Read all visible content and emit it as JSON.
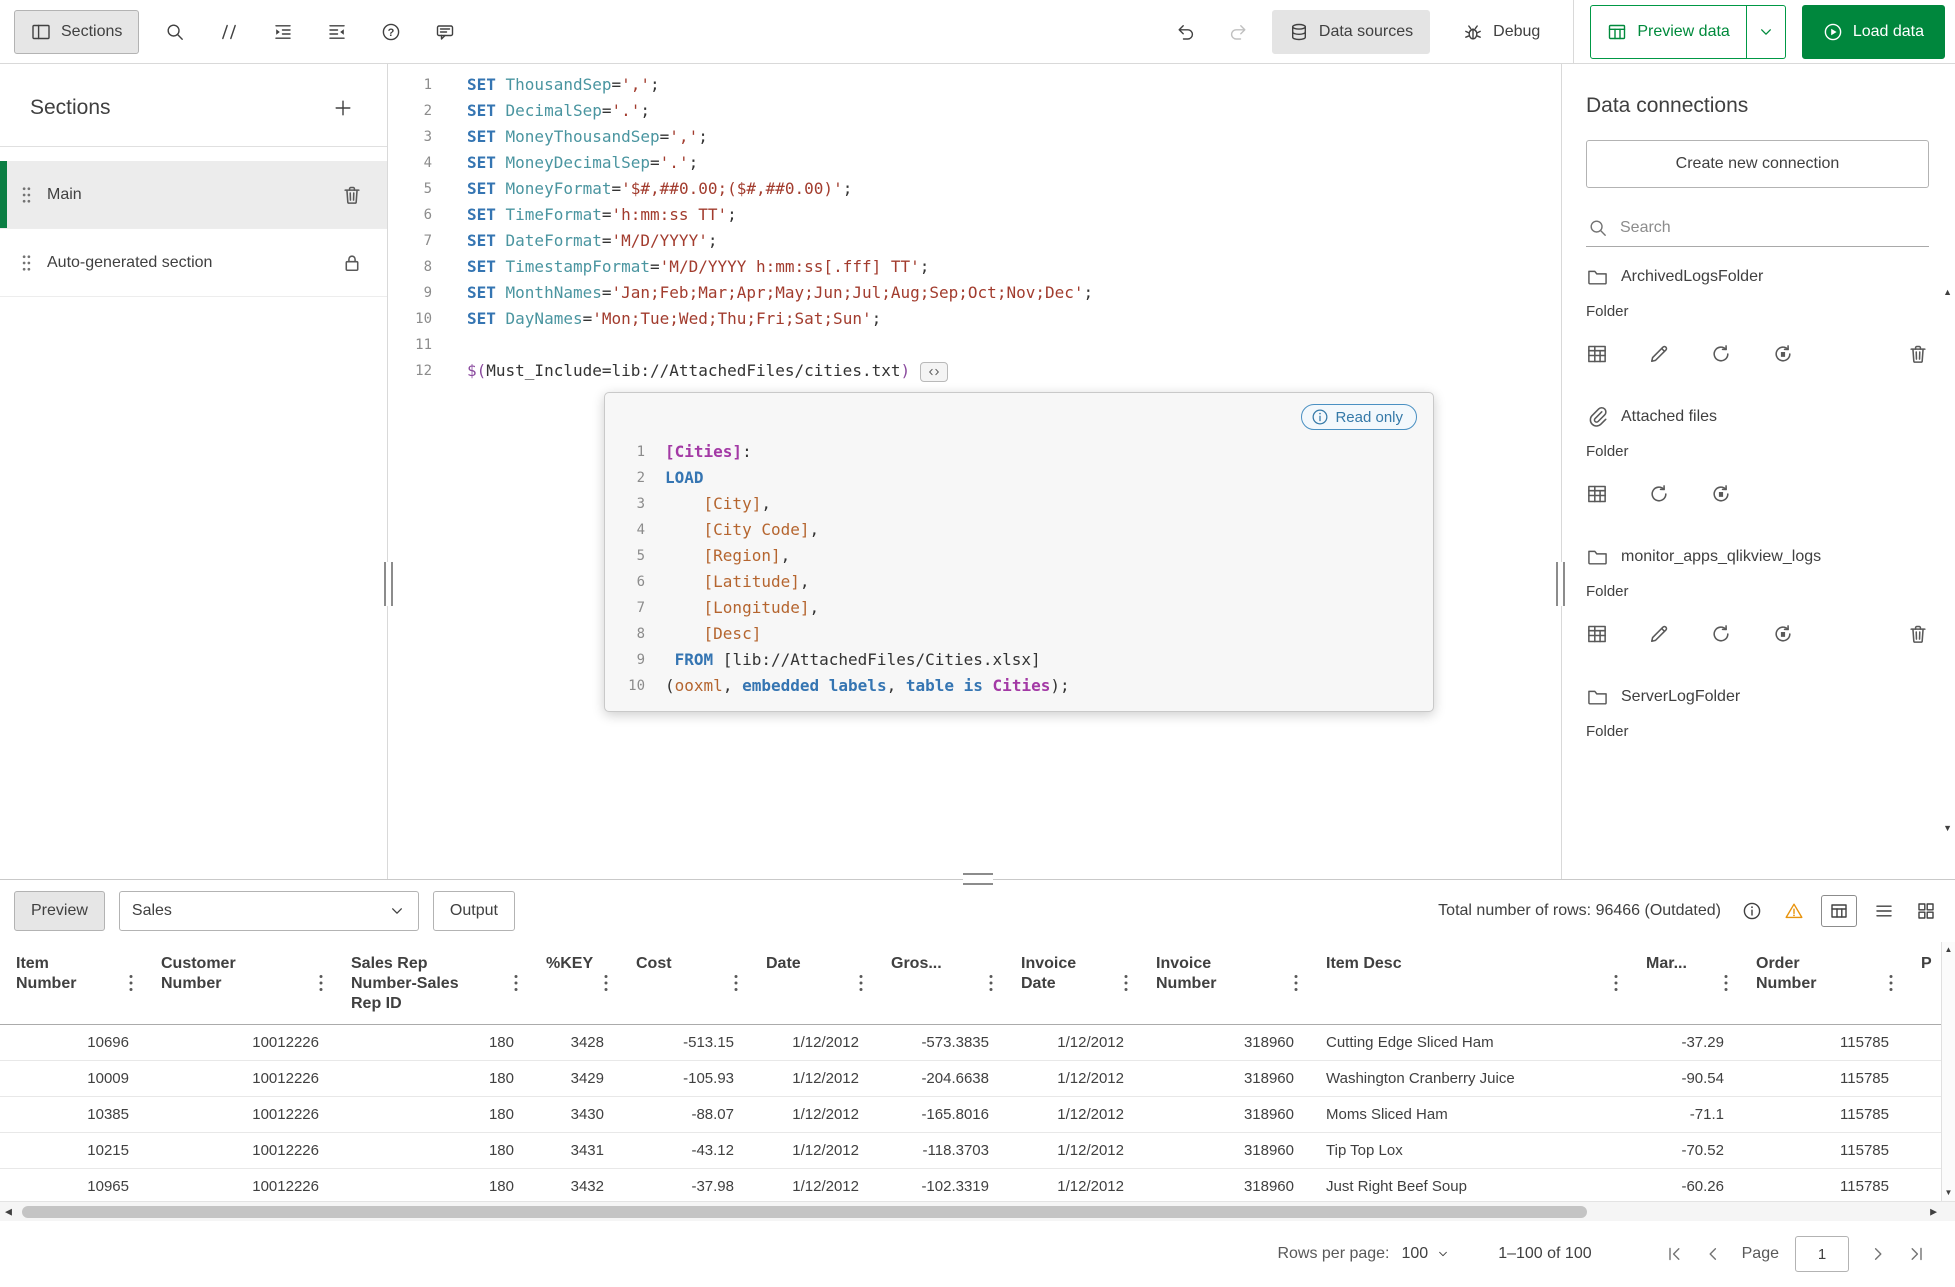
{
  "topbar": {
    "sections_button": "Sections",
    "data_sources_button": "Data sources",
    "debug_button": "Debug",
    "preview_data_button": "Preview data",
    "load_data_button": "Load data"
  },
  "sections_panel": {
    "title": "Sections",
    "items": [
      {
        "label": "Main",
        "selected": true,
        "action": "trash"
      },
      {
        "label": "Auto-generated section",
        "selected": false,
        "action": "lock"
      }
    ]
  },
  "editor": {
    "main_code": [
      {
        "num": "1",
        "tokens": [
          [
            "SET ",
            "kw"
          ],
          [
            "ThousandSep",
            "name"
          ],
          [
            "=",
            "plain"
          ],
          [
            "','",
            "str"
          ],
          [
            ";",
            "plain"
          ]
        ]
      },
      {
        "num": "2",
        "tokens": [
          [
            "SET ",
            "kw"
          ],
          [
            "DecimalSep",
            "name"
          ],
          [
            "=",
            "plain"
          ],
          [
            "'.'",
            "str"
          ],
          [
            ";",
            "plain"
          ]
        ]
      },
      {
        "num": "3",
        "tokens": [
          [
            "SET ",
            "kw"
          ],
          [
            "MoneyThousandSep",
            "name"
          ],
          [
            "=",
            "plain"
          ],
          [
            "','",
            "str"
          ],
          [
            ";",
            "plain"
          ]
        ]
      },
      {
        "num": "4",
        "tokens": [
          [
            "SET ",
            "kw"
          ],
          [
            "MoneyDecimalSep",
            "name"
          ],
          [
            "=",
            "plain"
          ],
          [
            "'.'",
            "str"
          ],
          [
            ";",
            "plain"
          ]
        ]
      },
      {
        "num": "5",
        "tokens": [
          [
            "SET ",
            "kw"
          ],
          [
            "MoneyFormat",
            "name"
          ],
          [
            "=",
            "plain"
          ],
          [
            "'$#,##0.00;($#,##0.00)'",
            "str"
          ],
          [
            ";",
            "plain"
          ]
        ]
      },
      {
        "num": "6",
        "tokens": [
          [
            "SET ",
            "kw"
          ],
          [
            "TimeFormat",
            "name"
          ],
          [
            "=",
            "plain"
          ],
          [
            "'h:mm:ss TT'",
            "str"
          ],
          [
            ";",
            "plain"
          ]
        ]
      },
      {
        "num": "7",
        "tokens": [
          [
            "SET ",
            "kw"
          ],
          [
            "DateFormat",
            "name"
          ],
          [
            "=",
            "plain"
          ],
          [
            "'M/D/YYYY'",
            "str"
          ],
          [
            ";",
            "plain"
          ]
        ]
      },
      {
        "num": "8",
        "tokens": [
          [
            "SET ",
            "kw"
          ],
          [
            "TimestampFormat",
            "name"
          ],
          [
            "=",
            "plain"
          ],
          [
            "'M/D/YYYY h:mm:ss[.fff] TT'",
            "str"
          ],
          [
            ";",
            "plain"
          ]
        ]
      },
      {
        "num": "9",
        "tokens": [
          [
            "SET ",
            "kw"
          ],
          [
            "MonthNames",
            "name"
          ],
          [
            "=",
            "plain"
          ],
          [
            "'Jan;Feb;Mar;Apr;May;Jun;Jul;Aug;Sep;Oct;Nov;Dec'",
            "str"
          ],
          [
            ";",
            "plain"
          ]
        ]
      },
      {
        "num": "10",
        "tokens": [
          [
            "SET ",
            "kw"
          ],
          [
            "DayNames",
            "name"
          ],
          [
            "=",
            "plain"
          ],
          [
            "'Mon;Tue;Wed;Thu;Fri;Sat;Sun'",
            "str"
          ],
          [
            ";",
            "plain"
          ]
        ]
      },
      {
        "num": "11",
        "tokens": []
      },
      {
        "num": "12",
        "tokens": [
          [
            "$(",
            "dollar"
          ],
          [
            "Must_Include=lib://AttachedFiles/cities.txt",
            "plain"
          ],
          [
            ")",
            "dollar"
          ]
        ],
        "widget": "code-expand"
      }
    ],
    "popup": {
      "read_only_label": "Read only",
      "code": [
        {
          "num": "1",
          "tokens": [
            [
              "[Cities]",
              "table"
            ],
            [
              ":",
              "plain"
            ]
          ]
        },
        {
          "num": "2",
          "tokens": [
            [
              "LOAD",
              "kw"
            ]
          ]
        },
        {
          "num": "3",
          "tokens": [
            [
              "    ",
              "plain"
            ],
            [
              "[City]",
              "field"
            ],
            [
              ",",
              "plain"
            ]
          ]
        },
        {
          "num": "4",
          "tokens": [
            [
              "    ",
              "plain"
            ],
            [
              "[City Code]",
              "field"
            ],
            [
              ",",
              "plain"
            ]
          ]
        },
        {
          "num": "5",
          "tokens": [
            [
              "    ",
              "plain"
            ],
            [
              "[Region]",
              "field"
            ],
            [
              ",",
              "plain"
            ]
          ]
        },
        {
          "num": "6",
          "tokens": [
            [
              "    ",
              "plain"
            ],
            [
              "[Latitude]",
              "field"
            ],
            [
              ",",
              "plain"
            ]
          ]
        },
        {
          "num": "7",
          "tokens": [
            [
              "    ",
              "plain"
            ],
            [
              "[Longitude]",
              "field"
            ],
            [
              ",",
              "plain"
            ]
          ]
        },
        {
          "num": "8",
          "tokens": [
            [
              "    ",
              "plain"
            ],
            [
              "[Desc]",
              "field"
            ]
          ]
        },
        {
          "num": "9",
          "tokens": [
            [
              " ",
              "plain"
            ],
            [
              "FROM",
              "kw"
            ],
            [
              " [lib://AttachedFiles/Cities.xlsx]",
              "plain"
            ]
          ]
        },
        {
          "num": "10",
          "tokens": [
            [
              "(",
              "plain"
            ],
            [
              "ooxml",
              "field"
            ],
            [
              ", ",
              "plain"
            ],
            [
              "embedded labels",
              "kw"
            ],
            [
              ", ",
              "plain"
            ],
            [
              "table is",
              "kw"
            ],
            [
              " ",
              "plain"
            ],
            [
              "Cities",
              "table"
            ],
            [
              ");",
              "plain"
            ]
          ]
        }
      ]
    }
  },
  "connections": {
    "title": "Data connections",
    "create_button": "Create new connection",
    "search_placeholder": "Search",
    "items": [
      {
        "name": "ArchivedLogsFolder",
        "type": "Folder",
        "icon": "folder",
        "actions": [
          "select-data",
          "edit",
          "sync",
          "reload-script"
        ],
        "deletable": true
      },
      {
        "name": "Attached files",
        "type": "Folder",
        "icon": "paperclip",
        "actions": [
          "select-data",
          "sync",
          "reload-script"
        ],
        "deletable": false
      },
      {
        "name": "monitor_apps_qlikview_logs",
        "type": "Folder",
        "icon": "folder",
        "actions": [
          "select-data",
          "edit",
          "sync",
          "reload-script"
        ],
        "deletable": true
      },
      {
        "name": "ServerLogFolder",
        "type": "Folder",
        "icon": "folder",
        "actions": [],
        "deletable": false
      }
    ]
  },
  "preview": {
    "preview_button": "Preview",
    "table_selector_value": "Sales",
    "output_button": "Output",
    "total_rows_text": "Total number of rows: 96466 (Outdated)",
    "columns": [
      {
        "label": "Item Number",
        "align": "right"
      },
      {
        "label": "Customer Number",
        "align": "right"
      },
      {
        "label": "Sales Rep Number-Sales Rep ID",
        "align": "right"
      },
      {
        "label": "%KEY",
        "align": "right"
      },
      {
        "label": "Cost",
        "align": "right"
      },
      {
        "label": "Date",
        "align": "right"
      },
      {
        "label": "Gros...",
        "align": "right"
      },
      {
        "label": "Invoice Date",
        "align": "right"
      },
      {
        "label": "Invoice Number",
        "align": "right"
      },
      {
        "label": "Item Desc",
        "align": "left"
      },
      {
        "label": "Mar...",
        "align": "right"
      },
      {
        "label": "Order Number",
        "align": "right"
      },
      {
        "label": "P",
        "align": "left"
      }
    ],
    "rows": [
      [
        "10696",
        "10012226",
        "180",
        "3428",
        "-513.15",
        "1/12/2012",
        "-573.3835",
        "1/12/2012",
        "318960",
        "Cutting Edge Sliced Ham",
        "-37.29",
        "115785",
        ""
      ],
      [
        "10009",
        "10012226",
        "180",
        "3429",
        "-105.93",
        "1/12/2012",
        "-204.6638",
        "1/12/2012",
        "318960",
        "Washington Cranberry Juice",
        "-90.54",
        "115785",
        ""
      ],
      [
        "10385",
        "10012226",
        "180",
        "3430",
        "-88.07",
        "1/12/2012",
        "-165.8016",
        "1/12/2012",
        "318960",
        "Moms Sliced Ham",
        "-71.1",
        "115785",
        ""
      ],
      [
        "10215",
        "10012226",
        "180",
        "3431",
        "-43.12",
        "1/12/2012",
        "-118.3703",
        "1/12/2012",
        "318960",
        "Tip Top Lox",
        "-70.52",
        "115785",
        ""
      ],
      [
        "10965",
        "10012226",
        "180",
        "3432",
        "-37.98",
        "1/12/2012",
        "-102.3319",
        "1/12/2012",
        "318960",
        "Just Right Beef Soup",
        "-60.26",
        "115785",
        ""
      ]
    ],
    "pagination": {
      "rows_per_page_label": "Rows per page:",
      "rows_per_page_value": "100",
      "range_text": "1–100 of 100",
      "page_label": "Page",
      "page_value": "1"
    }
  }
}
